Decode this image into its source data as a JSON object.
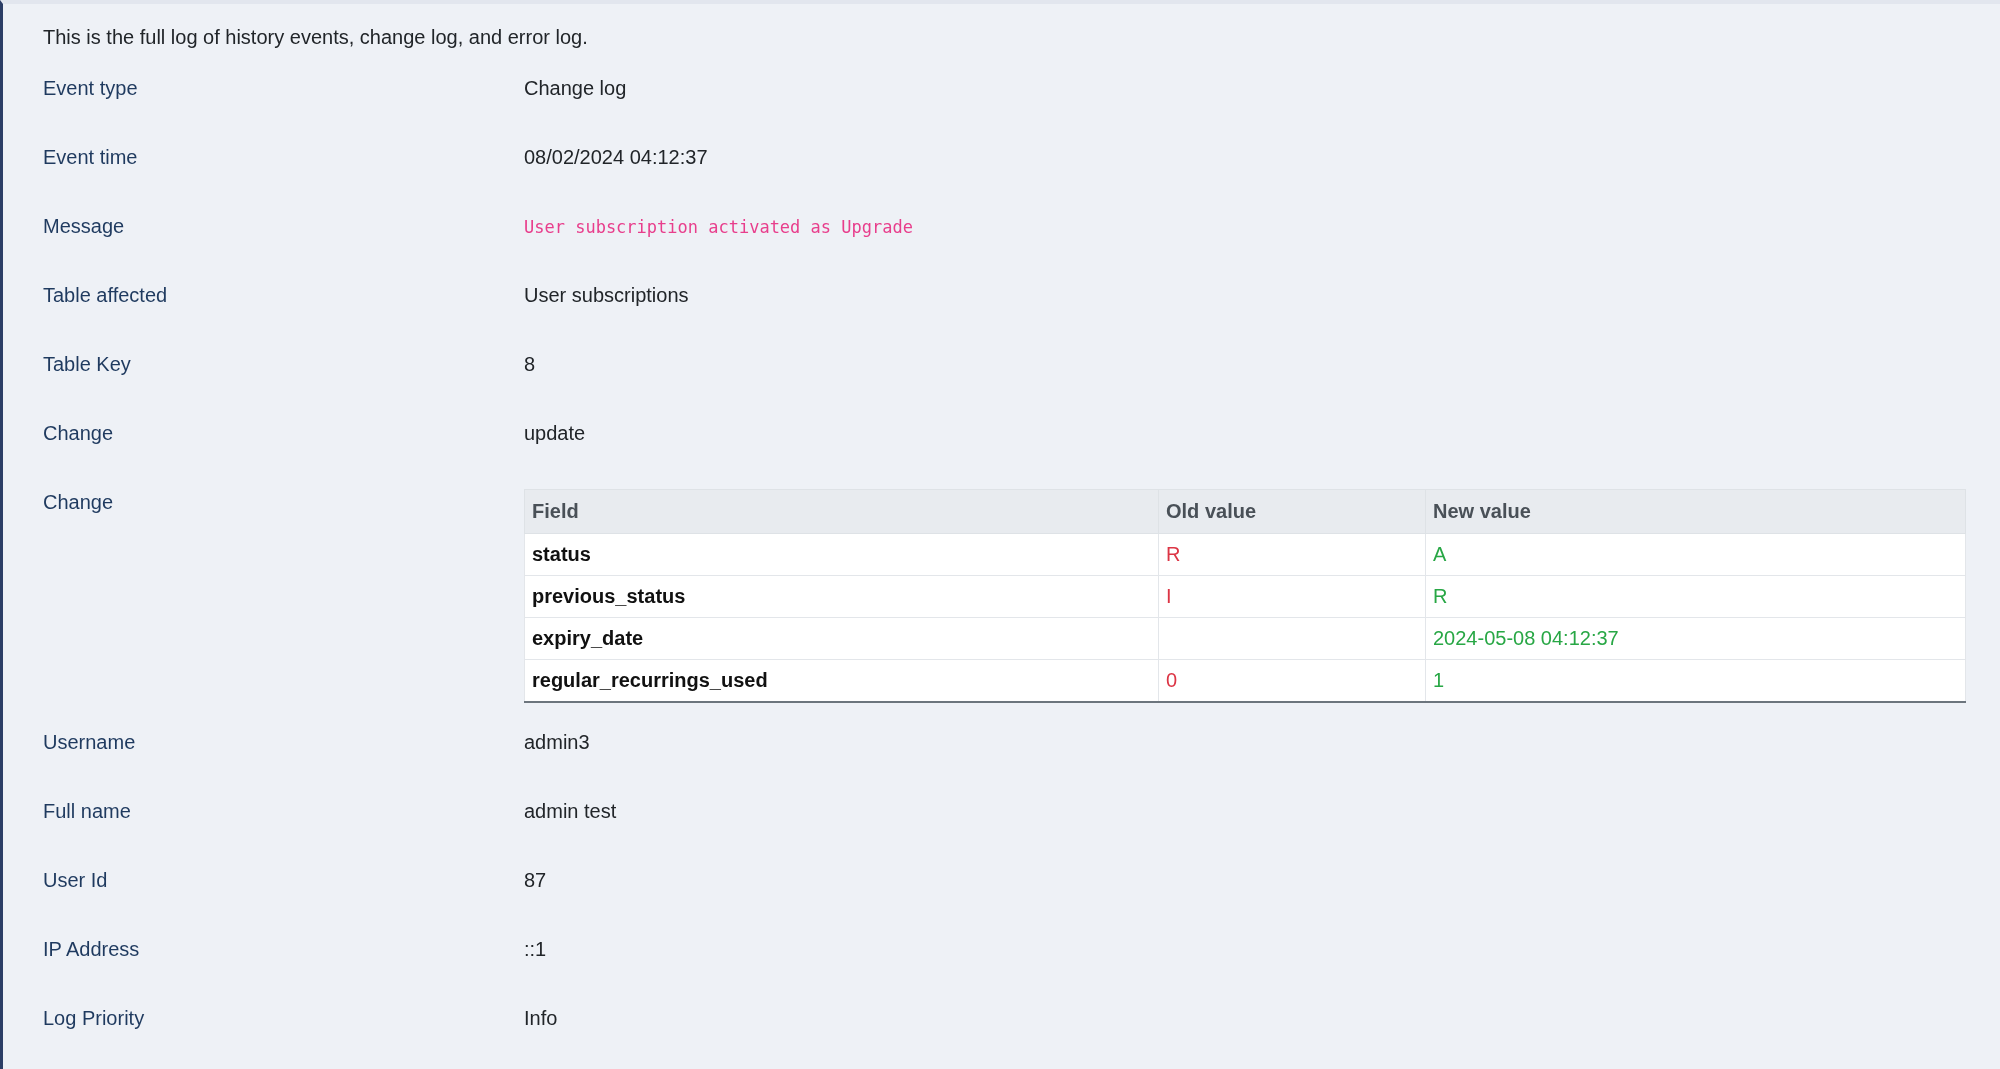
{
  "intro": "This is the full log of history events, change log, and error log.",
  "fields": [
    {
      "label": "Event type",
      "kind": "text",
      "value": "Change log"
    },
    {
      "label": "Event time",
      "kind": "text",
      "value": "08/02/2024 04:12:37"
    },
    {
      "label": "Message",
      "kind": "code",
      "value": "User subscription activated as Upgrade"
    },
    {
      "label": "Table affected",
      "kind": "text",
      "value": "User subscriptions"
    },
    {
      "label": "Table Key",
      "kind": "text",
      "value": "8"
    },
    {
      "label": "Change",
      "kind": "text",
      "value": "update"
    },
    {
      "label": "Change",
      "kind": "table",
      "table": {
        "columns": [
          "Field",
          "Old value",
          "New value"
        ],
        "rows": [
          [
            "status",
            "R",
            "A"
          ],
          [
            "previous_status",
            "I",
            "R"
          ],
          [
            "expiry_date",
            "",
            "2024-05-08 04:12:37"
          ],
          [
            "regular_recurrings_used",
            "0",
            "1"
          ]
        ]
      }
    },
    {
      "label": "Username",
      "kind": "text",
      "value": "admin3"
    },
    {
      "label": "Full name",
      "kind": "text",
      "value": "admin test"
    },
    {
      "label": "User Id",
      "kind": "text",
      "value": "87"
    },
    {
      "label": "IP Address",
      "kind": "text",
      "value": "::1"
    },
    {
      "label": "Log Priority",
      "kind": "text",
      "value": "Info"
    }
  ]
}
